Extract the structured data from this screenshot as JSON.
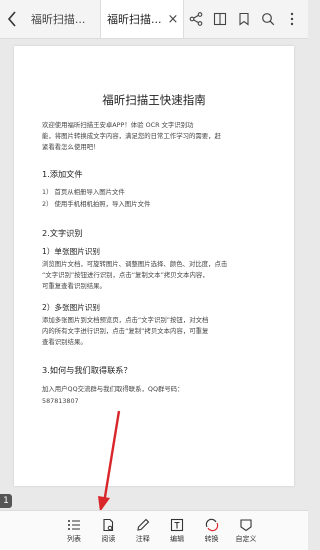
{
  "tabs": [
    {
      "label": "福昕扫描..."
    },
    {
      "label": "福昕扫描..."
    }
  ],
  "document": {
    "title": "福昕扫描王快速指南",
    "intro_1": "欢迎使用福昕扫描王安卓APP！体验 OCR 文字识别功",
    "intro_2": "能，将图片转换成文字内容，满足您的日常工作学习的需要，赶",
    "intro_3": "紧看看怎么使用吧！",
    "s1_heading": "1.添加文件",
    "s1_item1": "1）  首页从相册导入图片文件",
    "s1_item2": "2）  使用手机相机拍照，导入图片文件",
    "s2_heading": "2.文字识别",
    "s2_sub1": "1）单张图片识别",
    "s2_sub1_l1": "浏览图片文档，可旋转图片、调整图片选择、颜色、对比度，点击",
    "s2_sub1_l2": "“文字识别”按钮进行识别，点击“复制文本”拷贝文本内容，",
    "s2_sub1_l3": "可重复查看识别结果。",
    "s2_sub2": "2）多张图片识别",
    "s2_sub2_l1": "添加多张图片到文档预览页，点击“文字识别”按钮，对文档",
    "s2_sub2_l2": "内的所有文字进行识别，点击“复制”拷贝文本内容，可重复",
    "s2_sub2_l3": "查看识别结果。",
    "s3_heading": "3.如何与我们取得联系？",
    "s3_l1": "加入用户QQ交流群与我们取得联系，QQ群号码：",
    "s3_l2": "587813807"
  },
  "page_indicator": "1",
  "bottom_bar": [
    {
      "label": "列表",
      "icon": "list-icon"
    },
    {
      "label": "阅读",
      "icon": "read-icon"
    },
    {
      "label": "注释",
      "icon": "annotate-icon"
    },
    {
      "label": "编辑",
      "icon": "edit-icon"
    },
    {
      "label": "转换",
      "icon": "convert-icon"
    },
    {
      "label": "自定义",
      "icon": "customize-icon"
    }
  ],
  "colors": {
    "annotation_arrow": "#d9262a"
  }
}
